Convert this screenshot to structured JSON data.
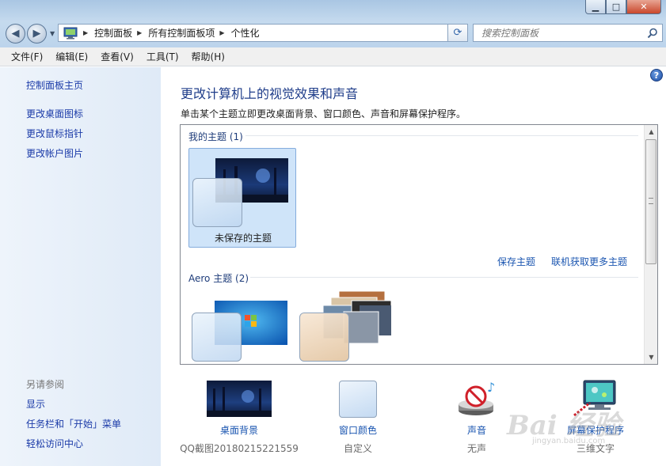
{
  "window": {
    "min_label": "▁",
    "max_label": "□",
    "close_label": "✕"
  },
  "address": {
    "crumbs": [
      "控制面板",
      "所有控制面板项",
      "个性化"
    ]
  },
  "search": {
    "placeholder": "搜索控制面板"
  },
  "menu": [
    "文件(F)",
    "编辑(E)",
    "查看(V)",
    "工具(T)",
    "帮助(H)"
  ],
  "sidebar": {
    "home": "控制面板主页",
    "links": [
      "更改桌面图标",
      "更改鼠标指针",
      "更改帐户图片"
    ],
    "see_also_heading": "另请参阅",
    "see_also": [
      "显示",
      "任务栏和「开始」菜单",
      "轻松访问中心"
    ]
  },
  "main": {
    "title": "更改计算机上的视觉效果和声音",
    "description": "单击某个主题立即更改桌面背景、窗口颜色、声音和屏幕保护程序。",
    "my_themes_heading": "我的主题 (1)",
    "unsaved_theme_label": "未保存的主题",
    "save_theme_link": "保存主题",
    "more_themes_link": "联机获取更多主题",
    "aero_heading": "Aero 主题 (2)"
  },
  "settings": [
    {
      "label": "桌面背景",
      "value": "QQ截图20180215221559"
    },
    {
      "label": "窗口颜色",
      "value": "自定义"
    },
    {
      "label": "声音",
      "value": "无声"
    },
    {
      "label": "屏幕保护程序",
      "value": "三维文字"
    }
  ],
  "watermark": {
    "brand": "Bai 经验",
    "url": "jingyan.baidu.com"
  },
  "colors": {
    "link": "#1a55b0",
    "title": "#1f3d8a",
    "sidebar_link": "#1a3aa8"
  }
}
